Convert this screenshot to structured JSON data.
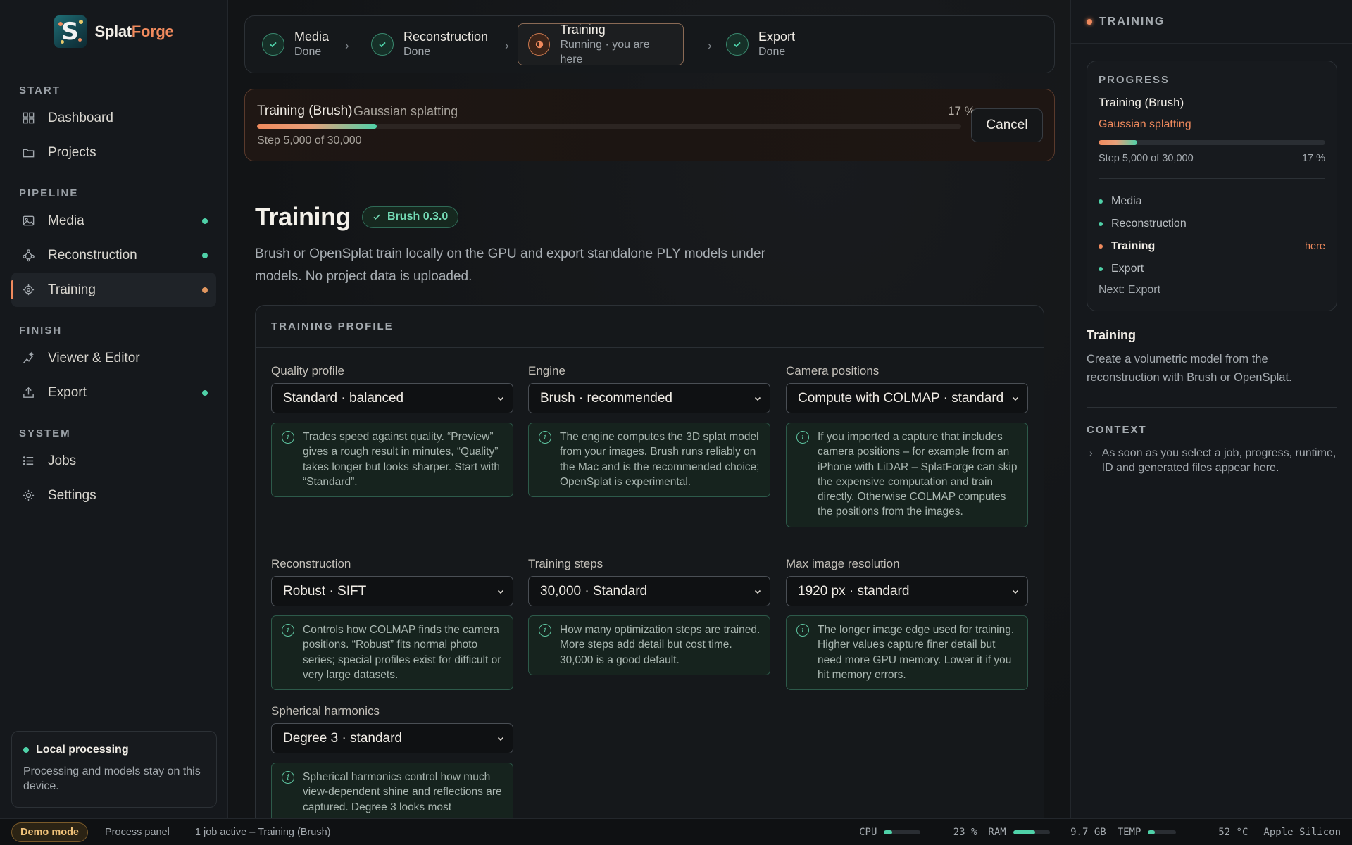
{
  "brand": {
    "name_a": "Splat",
    "name_b": "Forge",
    "logo_letter": "S"
  },
  "sidebar": {
    "sections": {
      "start": "START",
      "pipeline": "PIPELINE",
      "finish": "FINISH",
      "system": "SYSTEM"
    },
    "items": {
      "dashboard": "Dashboard",
      "projects": "Projects",
      "media": "Media",
      "reconstruction": "Reconstruction",
      "training": "Training",
      "viewer": "Viewer & Editor",
      "export": "Export",
      "jobs": "Jobs",
      "settings": "Settings"
    },
    "local": {
      "title": "Local processing",
      "text": "Processing and models stay on this device."
    }
  },
  "stepper": [
    {
      "label": "Media",
      "status": "Done"
    },
    {
      "label": "Reconstruction",
      "status": "Done"
    },
    {
      "label": "Training",
      "status": "Running · you are here"
    },
    {
      "label": "Export",
      "status": "Done"
    }
  ],
  "progress": {
    "title": "Training (Brush)",
    "subtitle": "Gaussian splatting",
    "percent_text": "17 %",
    "fraction": 0.17,
    "step_text": "Step 5,000 of 30,000",
    "cancel_label": "Cancel"
  },
  "page": {
    "title": "Training",
    "badge": "Brush 0.3.0",
    "description": "Brush or OpenSplat train locally on the GPU and export standalone PLY models under models. No project data is uploaded."
  },
  "profile": {
    "heading": "TRAINING PROFILE",
    "fields": {
      "quality": {
        "label": "Quality profile",
        "value": "Standard · balanced",
        "hint": "Trades speed against quality. “Preview” gives a rough result in minutes, “Quality” takes longer but looks sharper. Start with “Standard”."
      },
      "engine": {
        "label": "Engine",
        "value": "Brush · recommended",
        "hint": "The engine computes the 3D splat model from your images. Brush runs reliably on the Mac and is the recommended choice; OpenSplat is experimental."
      },
      "camera": {
        "label": "Camera positions",
        "value": "Compute with COLMAP · standard",
        "hint": "If you imported a capture that includes camera positions – for example from an iPhone with LiDAR – SplatForge can skip the expensive computation and train directly. Otherwise COLMAP computes the positions from the images."
      },
      "reconstruction": {
        "label": "Reconstruction",
        "value": "Robust · SIFT",
        "hint": "Controls how COLMAP finds the camera positions. “Robust” fits normal photo series; special profiles exist for difficult or very large datasets."
      },
      "steps": {
        "label": "Training steps",
        "value": "30,000 · Standard",
        "hint": "How many optimization steps are trained. More steps add detail but cost time. 30,000 is a good default."
      },
      "resolution": {
        "label": "Max image resolution",
        "value": "1920 px · standard",
        "hint": "The longer image edge used for training. Higher values capture finer detail but need more GPU memory. Lower it if you hit memory errors."
      },
      "harmonics": {
        "label": "Spherical harmonics",
        "value": "Degree 3 · standard",
        "hint": "Spherical harmonics control how much view-dependent shine and reflections are captured. Degree 3 looks most"
      }
    }
  },
  "right": {
    "header": "TRAINING",
    "kicker": "PROGRESS",
    "title": "Training (Brush)",
    "subtitle": "Gaussian splatting",
    "step_text": "Step 5,000 of 30,000",
    "percent_text": "17 %",
    "fraction": 0.17,
    "list": {
      "media": "Media",
      "reconstruction": "Reconstruction",
      "training": "Training",
      "export": "Export",
      "here": "here"
    },
    "next": "Next: Export",
    "section_title": "Training",
    "section_desc": "Create a volumetric model from the reconstruction with Brush or OpenSplat.",
    "context_heading": "CONTEXT",
    "context_text": "As soon as you select a job, progress, runtime, ID and generated files appear here."
  },
  "status": {
    "demo": "Demo mode",
    "panel": "Process panel",
    "jobs": "1 job active – Training (Brush)",
    "cpu_label": "CPU",
    "cpu_value": "23 %",
    "cpu_fraction": 0.23,
    "ram_label": "RAM",
    "ram_value": "9.7 GB",
    "ram_fraction": 0.6,
    "temp_label": "TEMP",
    "temp_value": "52 °C",
    "temp_fraction": 0.25,
    "chip": "Apple Silicon"
  },
  "colors": {
    "accent": "#f08a5d",
    "success": "#4fd1a8",
    "background": "#111316"
  }
}
